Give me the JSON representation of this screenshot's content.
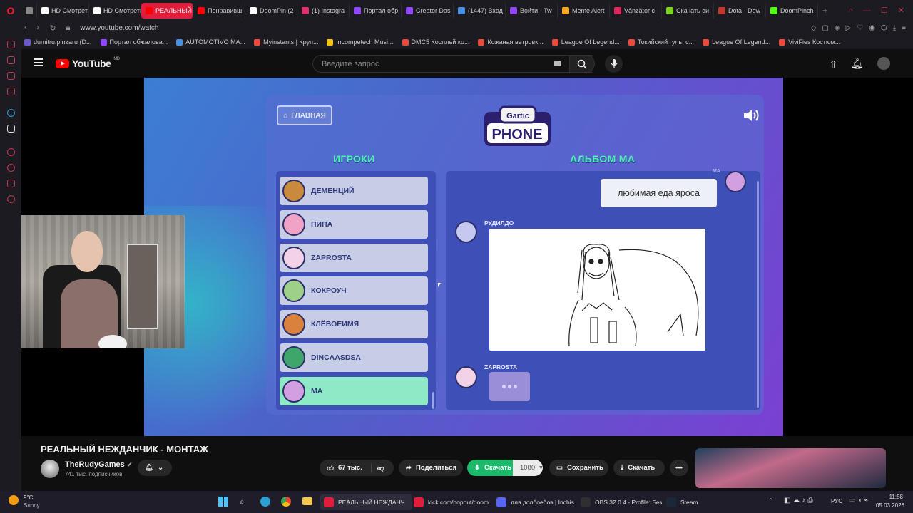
{
  "browser": {
    "tabs": [
      {
        "label": "",
        "icon": "grid-icon",
        "color": "#888888"
      },
      {
        "label": "HD Смотреть о",
        "icon": "hd-icon",
        "color": "#ffffff"
      },
      {
        "label": "HD Смотреть с",
        "icon": "hd-icon",
        "color": "#ffffff"
      },
      {
        "label": "РЕАЛЬНЫЙ НЕЖ",
        "icon": "youtube-icon",
        "color": "#ff0000",
        "active": true
      },
      {
        "label": "Понравивш",
        "icon": "youtube-icon",
        "color": "#ff0000"
      },
      {
        "label": "DoomPin (2",
        "icon": "tiktok-icon",
        "color": "#ffffff"
      },
      {
        "label": "(1) Instagra",
        "icon": "instagram-icon",
        "color": "#e1306c"
      },
      {
        "label": "Портал обр",
        "icon": "twitch-icon",
        "color": "#9146ff"
      },
      {
        "label": "Creator Das",
        "icon": "twitch-icon",
        "color": "#9146ff"
      },
      {
        "label": "(1447) Вход",
        "icon": "mail-icon",
        "color": "#4a90e2"
      },
      {
        "label": "Войти - Tw",
        "icon": "twitch-icon",
        "color": "#9146ff"
      },
      {
        "label": "Meme Alert",
        "icon": "meme-icon",
        "color": "#f5a623"
      },
      {
        "label": "Vânzător c",
        "icon": "red-icon",
        "color": "#e0245e"
      },
      {
        "label": "Скачать ви",
        "icon": "download-icon",
        "color": "#7ed321"
      },
      {
        "label": "Dota - Dow",
        "icon": "dota-icon",
        "color": "#c0392b"
      },
      {
        "label": "DoomPinch",
        "icon": "kick-icon",
        "color": "#53fc18"
      }
    ],
    "url": "www.youtube.com/watch",
    "bookmarks": [
      {
        "label": "dumitru.pinzaru (D...",
        "color": "#6a5acd"
      },
      {
        "label": "Портал обжалова...",
        "color": "#9146ff"
      },
      {
        "label": "AUTOMOTIVO MA...",
        "color": "#4a90e2"
      },
      {
        "label": "Myinstants | Круп...",
        "color": "#e74c3c"
      },
      {
        "label": "incompetech Musi...",
        "color": "#f1c40f"
      },
      {
        "label": "DMC5 Косплей ко...",
        "color": "#e74c3c"
      },
      {
        "label": "Кожаная ветровк...",
        "color": "#e74c3c"
      },
      {
        "label": "League Of Legend...",
        "color": "#e74c3c"
      },
      {
        "label": "Токийский гуль: с...",
        "color": "#e74c3c"
      },
      {
        "label": "League Of Legend...",
        "color": "#e74c3c"
      },
      {
        "label": "ViviFies Костюм...",
        "color": "#e74c3c"
      }
    ]
  },
  "youtube": {
    "logo": "YouTube",
    "logo_badge": "MD",
    "search_placeholder": "Введите запрос"
  },
  "game": {
    "home_label": "ГЛАВНАЯ",
    "logo_top": "Gartic",
    "logo_bottom": "PHONE",
    "players_title": "ИГРОКИ",
    "album_title": "АЛЬБОМ MA",
    "players": [
      {
        "name": "ДЕМЕНЦИЙ",
        "color": "#c98a3c"
      },
      {
        "name": "ПИПА",
        "color": "#f0a3c4"
      },
      {
        "name": "ZAPROSTA",
        "color": "#f2d2e4"
      },
      {
        "name": "КОКРОУЧ",
        "color": "#9fd08a"
      },
      {
        "name": "КЛЁВОЕИМЯ",
        "color": "#d9823d"
      },
      {
        "name": "DINCAASDSA",
        "color": "#3fa66b"
      },
      {
        "name": "MA",
        "color": "#d2a0e0",
        "active": true
      }
    ],
    "album_owner_tag": "MA",
    "prompt_text": "любимая еда яроса",
    "drawing_author": "РУДИЛДО",
    "typing_author": "ZAPROSTA"
  },
  "video_info": {
    "title": "РЕАЛЬНЫЙ НЕЖДАНЧИК - МОНТАЖ",
    "channel": "TheRudyGames",
    "subscribers": "741 тыс. подписчиков",
    "likes": "67 тыс.",
    "share": "Поделиться",
    "download": "Скачать",
    "quality": "1080",
    "save": "Сохранить",
    "download2": "Скачать"
  },
  "taskbar": {
    "weather_temp": "9°C",
    "weather_desc": "Sunny",
    "items": [
      {
        "label": "РЕАЛЬНЫЙ НЕЖДАНЧ",
        "color": "#e01e3c",
        "active": true
      },
      {
        "label": "kick.com/popout/doom",
        "color": "#e01e3c"
      },
      {
        "label": "для долбоебов | Inchis",
        "color": "#5865f2"
      },
      {
        "label": "OBS 32.0.4 - Profile: Без",
        "color": "#302e31"
      },
      {
        "label": "Steam",
        "color": "#1b2838"
      }
    ],
    "lang": "РУС",
    "time": "11:58",
    "date": "05.03.2026"
  }
}
